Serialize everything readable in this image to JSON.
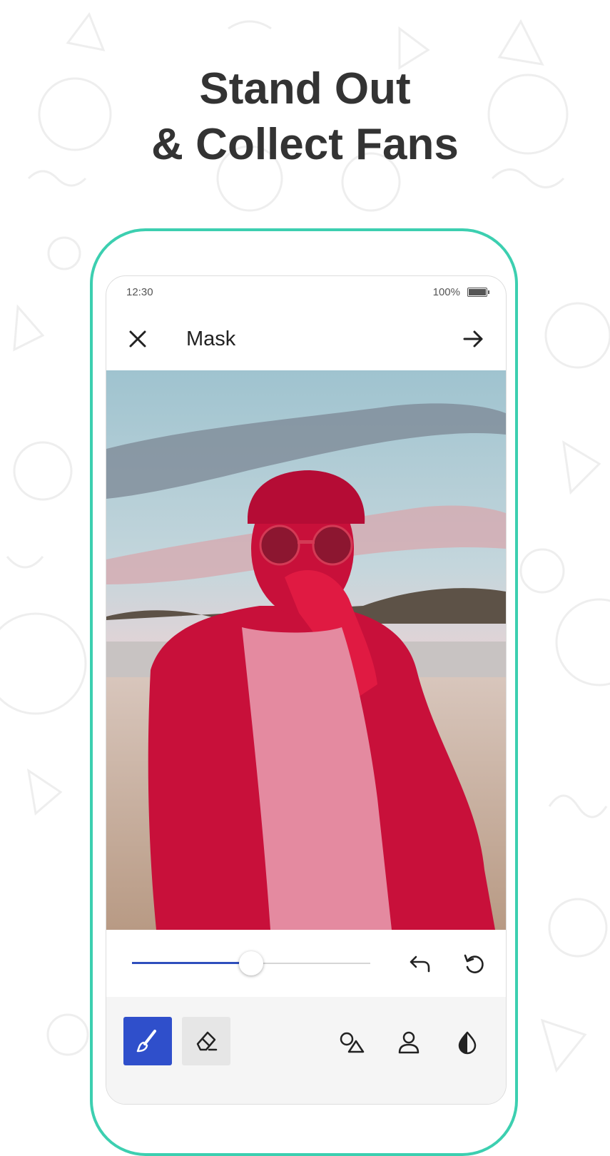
{
  "headline": {
    "line1": "Stand Out",
    "line2": "& Collect Fans"
  },
  "status_bar": {
    "time": "12:30",
    "battery_text": "100%"
  },
  "app_bar": {
    "title": "Mask",
    "close_icon": "close-icon",
    "next_icon": "arrow-right-icon"
  },
  "photo": {
    "description_icon": "photo",
    "mask_color": "#d3103c"
  },
  "controls": {
    "brush_size_fraction": 0.5,
    "undo_icon": "undo-icon",
    "reset_icon": "reset-icon"
  },
  "toolbar": {
    "brush_icon": "brush-icon",
    "eraser_icon": "eraser-icon",
    "shapes_icon": "shapes-icon",
    "person_icon": "person-icon",
    "contrast_icon": "contrast-icon"
  },
  "colors": {
    "accent": "#2f4fcb",
    "phone_frame": "#3ccfb0",
    "headline": "#333333"
  }
}
